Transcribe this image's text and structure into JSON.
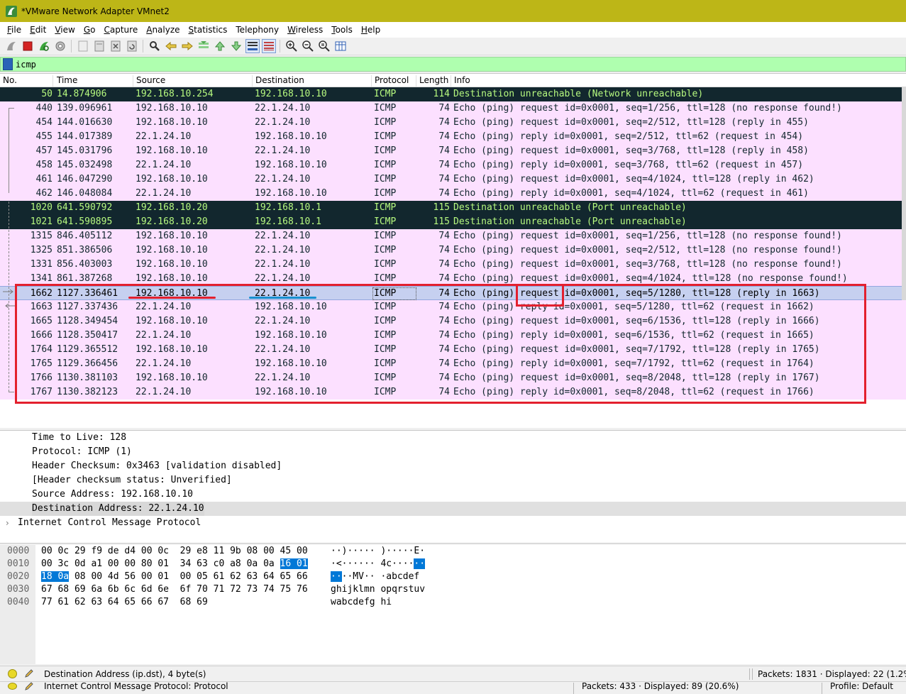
{
  "window": {
    "title": "*VMware Network Adapter VMnet2"
  },
  "menu": [
    {
      "label": "File",
      "u": "F",
      "rest": "ile"
    },
    {
      "label": "Edit",
      "u": "E",
      "rest": "dit"
    },
    {
      "label": "View",
      "u": "V",
      "rest": "iew"
    },
    {
      "label": "Go",
      "u": "G",
      "rest": "o"
    },
    {
      "label": "Capture",
      "u": "C",
      "rest": "apture"
    },
    {
      "label": "Analyze",
      "u": "A",
      "rest": "nalyze"
    },
    {
      "label": "Statistics",
      "u": "S",
      "rest": "tatistics"
    },
    {
      "label": "Telephony",
      "u": "",
      "rest": "Telephony"
    },
    {
      "label": "Wireless",
      "u": "W",
      "rest": "ireless"
    },
    {
      "label": "Tools",
      "u": "T",
      "rest": "ools"
    },
    {
      "label": "Help",
      "u": "H",
      "rest": "elp"
    }
  ],
  "filter": {
    "value": "icmp"
  },
  "columns": [
    "No.",
    "Time",
    "Source",
    "Destination",
    "Protocol",
    "Length",
    "Info"
  ],
  "packets": [
    {
      "no": "50",
      "time": "14.874906",
      "src": "192.168.10.254",
      "dst": "192.168.10.10",
      "proto": "ICMP",
      "len": "114",
      "info": "Destination unreachable (Network unreachable)",
      "kind": "unreach"
    },
    {
      "no": "440",
      "time": "139.096961",
      "src": "192.168.10.10",
      "dst": "22.1.24.10",
      "proto": "ICMP",
      "len": "74",
      "info": "Echo (ping) request  id=0x0001, seq=1/256, ttl=128 (no response found!)",
      "kind": "echo"
    },
    {
      "no": "454",
      "time": "144.016630",
      "src": "192.168.10.10",
      "dst": "22.1.24.10",
      "proto": "ICMP",
      "len": "74",
      "info": "Echo (ping) request  id=0x0001, seq=2/512, ttl=128 (reply in 455)",
      "kind": "echo"
    },
    {
      "no": "455",
      "time": "144.017389",
      "src": "22.1.24.10",
      "dst": "192.168.10.10",
      "proto": "ICMP",
      "len": "74",
      "info": "Echo (ping) reply    id=0x0001, seq=2/512, ttl=62 (request in 454)",
      "kind": "echo"
    },
    {
      "no": "457",
      "time": "145.031796",
      "src": "192.168.10.10",
      "dst": "22.1.24.10",
      "proto": "ICMP",
      "len": "74",
      "info": "Echo (ping) request  id=0x0001, seq=3/768, ttl=128 (reply in 458)",
      "kind": "echo"
    },
    {
      "no": "458",
      "time": "145.032498",
      "src": "22.1.24.10",
      "dst": "192.168.10.10",
      "proto": "ICMP",
      "len": "74",
      "info": "Echo (ping) reply    id=0x0001, seq=3/768, ttl=62 (request in 457)",
      "kind": "echo"
    },
    {
      "no": "461",
      "time": "146.047290",
      "src": "192.168.10.10",
      "dst": "22.1.24.10",
      "proto": "ICMP",
      "len": "74",
      "info": "Echo (ping) request  id=0x0001, seq=4/1024, ttl=128 (reply in 462)",
      "kind": "echo"
    },
    {
      "no": "462",
      "time": "146.048084",
      "src": "22.1.24.10",
      "dst": "192.168.10.10",
      "proto": "ICMP",
      "len": "74",
      "info": "Echo (ping) reply    id=0x0001, seq=4/1024, ttl=62 (request in 461)",
      "kind": "echo"
    },
    {
      "no": "1020",
      "time": "641.590792",
      "src": "192.168.10.20",
      "dst": "192.168.10.1",
      "proto": "ICMP",
      "len": "115",
      "info": "Destination unreachable (Port unreachable)",
      "kind": "unreach"
    },
    {
      "no": "1021",
      "time": "641.590895",
      "src": "192.168.10.20",
      "dst": "192.168.10.1",
      "proto": "ICMP",
      "len": "115",
      "info": "Destination unreachable (Port unreachable)",
      "kind": "unreach"
    },
    {
      "no": "1315",
      "time": "846.405112",
      "src": "192.168.10.10",
      "dst": "22.1.24.10",
      "proto": "ICMP",
      "len": "74",
      "info": "Echo (ping) request  id=0x0001, seq=1/256, ttl=128 (no response found!)",
      "kind": "echo"
    },
    {
      "no": "1325",
      "time": "851.386506",
      "src": "192.168.10.10",
      "dst": "22.1.24.10",
      "proto": "ICMP",
      "len": "74",
      "info": "Echo (ping) request  id=0x0001, seq=2/512, ttl=128 (no response found!)",
      "kind": "echo"
    },
    {
      "no": "1331",
      "time": "856.403003",
      "src": "192.168.10.10",
      "dst": "22.1.24.10",
      "proto": "ICMP",
      "len": "74",
      "info": "Echo (ping) request  id=0x0001, seq=3/768, ttl=128 (no response found!)",
      "kind": "echo"
    },
    {
      "no": "1341",
      "time": "861.387268",
      "src": "192.168.10.10",
      "dst": "22.1.24.10",
      "proto": "ICMP",
      "len": "74",
      "info": "Echo (ping) request  id=0x0001, seq=4/1024, ttl=128 (no response found!)",
      "kind": "echo"
    },
    {
      "no": "1662",
      "time": "1127.336461",
      "src": "192.168.10.10",
      "dst": "22.1.24.10",
      "proto": "ICMP",
      "len": "74",
      "info": "Echo (ping) request  id=0x0001, seq=5/1280, ttl=128 (reply in 1663)",
      "kind": "sel"
    },
    {
      "no": "1663",
      "time": "1127.337436",
      "src": "22.1.24.10",
      "dst": "192.168.10.10",
      "proto": "ICMP",
      "len": "74",
      "info": "Echo (ping) reply    id=0x0001, seq=5/1280, ttl=62 (request in 1662)",
      "kind": "echo"
    },
    {
      "no": "1665",
      "time": "1128.349454",
      "src": "192.168.10.10",
      "dst": "22.1.24.10",
      "proto": "ICMP",
      "len": "74",
      "info": "Echo (ping) request  id=0x0001, seq=6/1536, ttl=128 (reply in 1666)",
      "kind": "echo"
    },
    {
      "no": "1666",
      "time": "1128.350417",
      "src": "22.1.24.10",
      "dst": "192.168.10.10",
      "proto": "ICMP",
      "len": "74",
      "info": "Echo (ping) reply    id=0x0001, seq=6/1536, ttl=62 (request in 1665)",
      "kind": "echo"
    },
    {
      "no": "1764",
      "time": "1129.365512",
      "src": "192.168.10.10",
      "dst": "22.1.24.10",
      "proto": "ICMP",
      "len": "74",
      "info": "Echo (ping) request  id=0x0001, seq=7/1792, ttl=128 (reply in 1765)",
      "kind": "echo"
    },
    {
      "no": "1765",
      "time": "1129.366456",
      "src": "22.1.24.10",
      "dst": "192.168.10.10",
      "proto": "ICMP",
      "len": "74",
      "info": "Echo (ping) reply    id=0x0001, seq=7/1792, ttl=62 (request in 1764)",
      "kind": "echo"
    },
    {
      "no": "1766",
      "time": "1130.381103",
      "src": "192.168.10.10",
      "dst": "22.1.24.10",
      "proto": "ICMP",
      "len": "74",
      "info": "Echo (ping) request  id=0x0001, seq=8/2048, ttl=128 (reply in 1767)",
      "kind": "echo"
    },
    {
      "no": "1767",
      "time": "1130.382123",
      "src": "22.1.24.10",
      "dst": "192.168.10.10",
      "proto": "ICMP",
      "len": "74",
      "info": "Echo (ping) reply    id=0x0001, seq=8/2048, ttl=62 (request in 1766)",
      "kind": "echo"
    }
  ],
  "details": [
    {
      "text": "Time to Live: 128",
      "indent": 1,
      "sel": false
    },
    {
      "text": "Protocol: ICMP (1)",
      "indent": 1,
      "sel": false
    },
    {
      "text": "Header Checksum: 0x3463 [validation disabled]",
      "indent": 1,
      "sel": false
    },
    {
      "text": "[Header checksum status: Unverified]",
      "indent": 1,
      "sel": false
    },
    {
      "text": "Source Address: 192.168.10.10",
      "indent": 1,
      "sel": false
    },
    {
      "text": "Destination Address: 22.1.24.10",
      "indent": 1,
      "sel": true
    },
    {
      "text": "Internet Control Message Protocol",
      "indent": 0,
      "sel": false,
      "expander": "›"
    }
  ],
  "bytes": [
    {
      "off": "0000",
      "hex": [
        "00 0c 29 f9 de d4 00 0c  29 e8 11 9b 08 00 45 00"
      ],
      "asc": "··)····· )·····E·"
    },
    {
      "off": "0010",
      "hex": [
        "00 3c 0d a1 00 00 80 01  34 63 c0 a8 0a 0a ",
        "16 01"
      ],
      "asc": "·<······ 4c····",
      "asc_hl": "··"
    },
    {
      "off": "0020",
      "hex_hl_first": "18 0a",
      "hex": [
        " 08 00 4d 56 00 01  00 05 61 62 63 64 65 66"
      ],
      "asc_hl_first": "··",
      "asc": "··MV·· ·abcdef"
    },
    {
      "off": "0030",
      "hex": [
        "67 68 69 6a 6b 6c 6d 6e  6f 70 71 72 73 74 75 76"
      ],
      "asc": "ghijklmn opqrstuv"
    },
    {
      "off": "0040",
      "hex": [
        "77 61 62 63 64 65 66 67  68 69"
      ],
      "asc": "wabcdefg hi"
    }
  ],
  "status": {
    "field": "Destination Address (ip.dst), 4 byte(s)",
    "packets": "Packets: 1831 · Displayed: 22 (1.2%)",
    "field2": "Internet Control Message Protocol: Protocol",
    "packets2": "Packets: 433 · Displayed: 89 (20.6%)",
    "profile": "Profile: Default"
  },
  "colors": {
    "echo_bg": "#fce0ff",
    "unreach_bg": "#12272e",
    "unreach_fg": "#b6f97f",
    "selected_bg": "#c6d0f0",
    "filter_bg": "#afffaf",
    "titlebar": "#bdb617",
    "annotation_red": "#e3202e",
    "annotation_blue": "#1890d0"
  }
}
